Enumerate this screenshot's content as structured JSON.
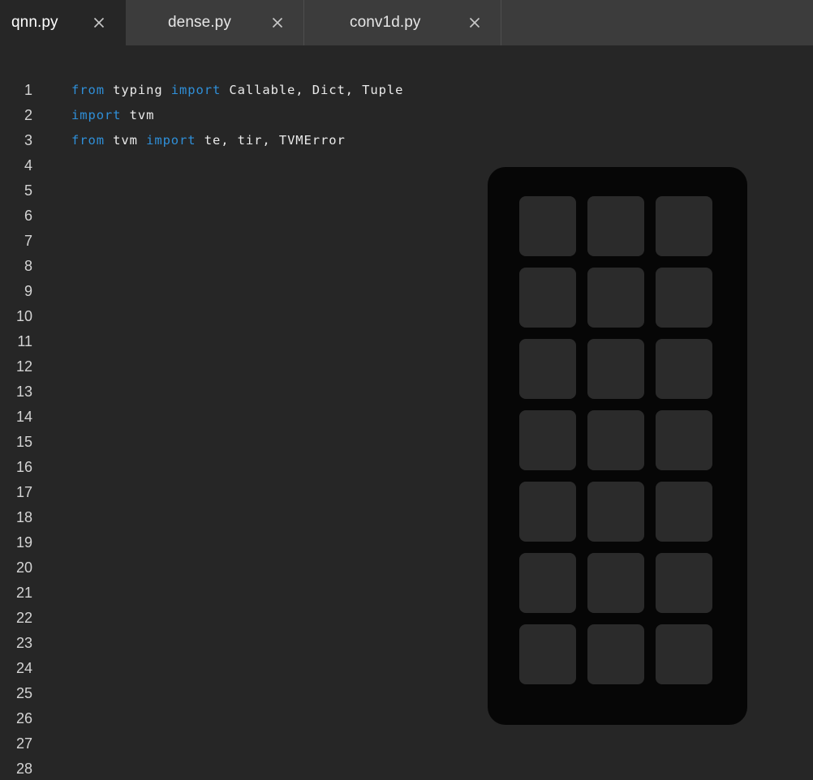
{
  "window": {
    "title": "qnn.py",
    "background_color": "#262626"
  },
  "tabbar": {
    "background_color": "#3c3c3c",
    "close_icon_name": "close-icon",
    "tabs": [
      {
        "label": "qnn.py",
        "active": true,
        "close_label": "×"
      },
      {
        "label": "dense.py",
        "active": false,
        "close_label": "×"
      },
      {
        "label": "conv1d.py",
        "active": false,
        "close_label": "×"
      }
    ]
  },
  "editor": {
    "keyword_color": "#2f8fd8",
    "text_color": "#e8e8e8",
    "gutter_color": "#d4d4d4",
    "first_line_number": 1,
    "last_line_number": 28,
    "lines": [
      {
        "number": "1",
        "tokens": [
          {
            "text": "from",
            "type": "keyword"
          },
          {
            "text": " typing ",
            "type": "plain"
          },
          {
            "text": "import",
            "type": "keyword"
          },
          {
            "text": " Callable, Dict, Tuple",
            "type": "plain"
          }
        ]
      },
      {
        "number": "2",
        "tokens": [
          {
            "text": "import",
            "type": "keyword"
          },
          {
            "text": " tvm",
            "type": "plain"
          }
        ]
      },
      {
        "number": "3",
        "tokens": [
          {
            "text": "from",
            "type": "keyword"
          },
          {
            "text": " tvm ",
            "type": "plain"
          },
          {
            "text": "import",
            "type": "keyword"
          },
          {
            "text": " te, tir, TVMError",
            "type": "plain"
          }
        ]
      },
      {
        "number": "4",
        "tokens": []
      },
      {
        "number": "5",
        "tokens": []
      },
      {
        "number": "6",
        "tokens": []
      },
      {
        "number": "7",
        "tokens": []
      },
      {
        "number": "8",
        "tokens": []
      },
      {
        "number": "9",
        "tokens": []
      },
      {
        "number": "10",
        "tokens": []
      },
      {
        "number": "11",
        "tokens": []
      },
      {
        "number": "12",
        "tokens": []
      },
      {
        "number": "13",
        "tokens": []
      },
      {
        "number": "14",
        "tokens": []
      },
      {
        "number": "15",
        "tokens": []
      },
      {
        "number": "16",
        "tokens": []
      },
      {
        "number": "17",
        "tokens": []
      },
      {
        "number": "18",
        "tokens": []
      },
      {
        "number": "19",
        "tokens": []
      },
      {
        "number": "20",
        "tokens": []
      },
      {
        "number": "21",
        "tokens": []
      },
      {
        "number": "22",
        "tokens": []
      },
      {
        "number": "23",
        "tokens": []
      },
      {
        "number": "24",
        "tokens": []
      },
      {
        "number": "25",
        "tokens": []
      },
      {
        "number": "26",
        "tokens": []
      },
      {
        "number": "27",
        "tokens": []
      },
      {
        "number": "28",
        "tokens": []
      }
    ]
  },
  "overlay_panel": {
    "background_color": "#060606",
    "tile_color": "#2b2b2b",
    "columns": 3,
    "rows": 7,
    "tile_count": 21,
    "tiles": [
      {
        "label": ""
      },
      {
        "label": ""
      },
      {
        "label": ""
      },
      {
        "label": ""
      },
      {
        "label": ""
      },
      {
        "label": ""
      },
      {
        "label": ""
      },
      {
        "label": ""
      },
      {
        "label": ""
      },
      {
        "label": ""
      },
      {
        "label": ""
      },
      {
        "label": ""
      },
      {
        "label": ""
      },
      {
        "label": ""
      },
      {
        "label": ""
      },
      {
        "label": ""
      },
      {
        "label": ""
      },
      {
        "label": ""
      },
      {
        "label": ""
      },
      {
        "label": ""
      },
      {
        "label": ""
      }
    ]
  }
}
